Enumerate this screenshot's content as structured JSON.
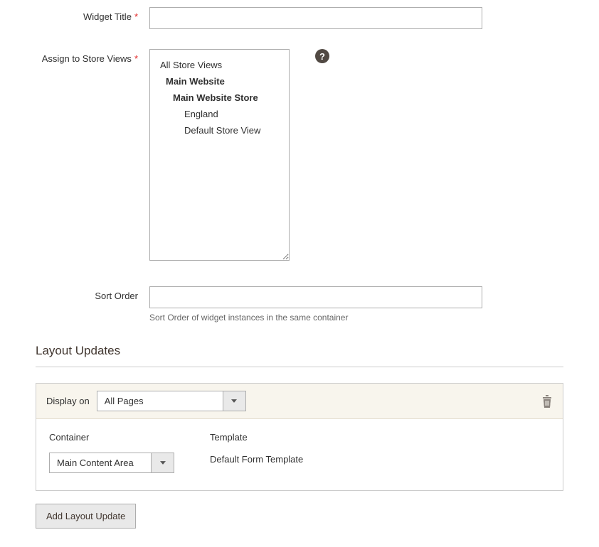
{
  "form": {
    "widget_title": {
      "label": "Widget Title",
      "value": ""
    },
    "store_views": {
      "label": "Assign to Store Views",
      "options": {
        "all": "All Store Views",
        "website": "Main Website",
        "store_group": "Main Website Store",
        "view1": "England",
        "view2": "Default Store View"
      }
    },
    "sort_order": {
      "label": "Sort Order",
      "value": "",
      "help": "Sort Order of widget instances in the same container"
    }
  },
  "layout": {
    "section_title": "Layout Updates",
    "display_on": {
      "label": "Display on",
      "value": "All Pages"
    },
    "container": {
      "label": "Container",
      "value": "Main Content Area"
    },
    "template": {
      "label": "Template",
      "value": "Default Form Template"
    },
    "add_button": "Add Layout Update"
  },
  "help_icon": "?"
}
